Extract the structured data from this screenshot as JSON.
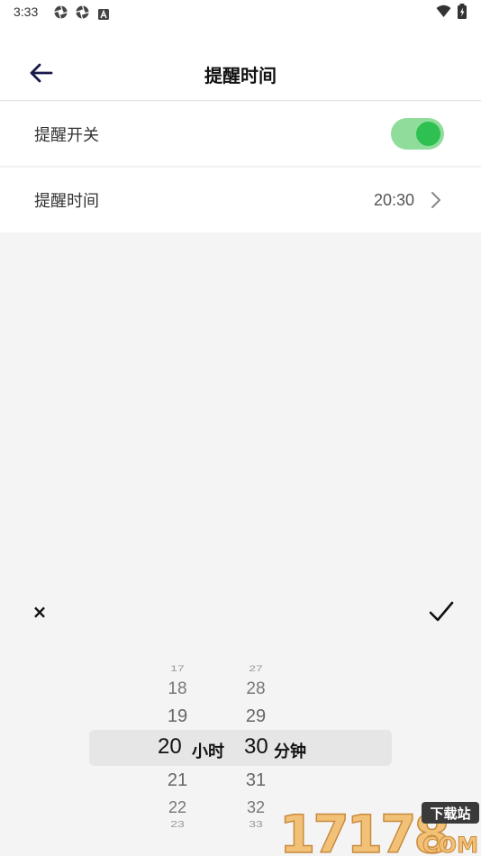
{
  "status_bar": {
    "time": "3:33",
    "icons": [
      "aperture-icon",
      "aperture-icon",
      "font-a-icon",
      "wifi-icon",
      "battery-icon"
    ]
  },
  "header": {
    "title": "提醒时间",
    "back_icon": "arrow-left-icon"
  },
  "settings": {
    "reminder_switch": {
      "label": "提醒开关",
      "enabled": true,
      "accent": "#2ec151"
    },
    "reminder_time": {
      "label": "提醒时间",
      "value": "20:30",
      "icon": "chevron-right-icon"
    }
  },
  "picker": {
    "close_icon": "close-icon",
    "close_glyph": "×",
    "confirm_icon": "check-icon",
    "hours": {
      "above": [
        "17",
        "18",
        "19"
      ],
      "selected": "20",
      "below": [
        "21",
        "22",
        "23"
      ],
      "unit": "小时"
    },
    "minutes": {
      "above": [
        "27",
        "28",
        "29"
      ],
      "selected": "30",
      "below": [
        "31",
        "32",
        "33"
      ],
      "unit": "分钟"
    }
  },
  "watermark": {
    "text": "17178",
    "sub_top": "下载站",
    "sub_bottom": "COM"
  }
}
